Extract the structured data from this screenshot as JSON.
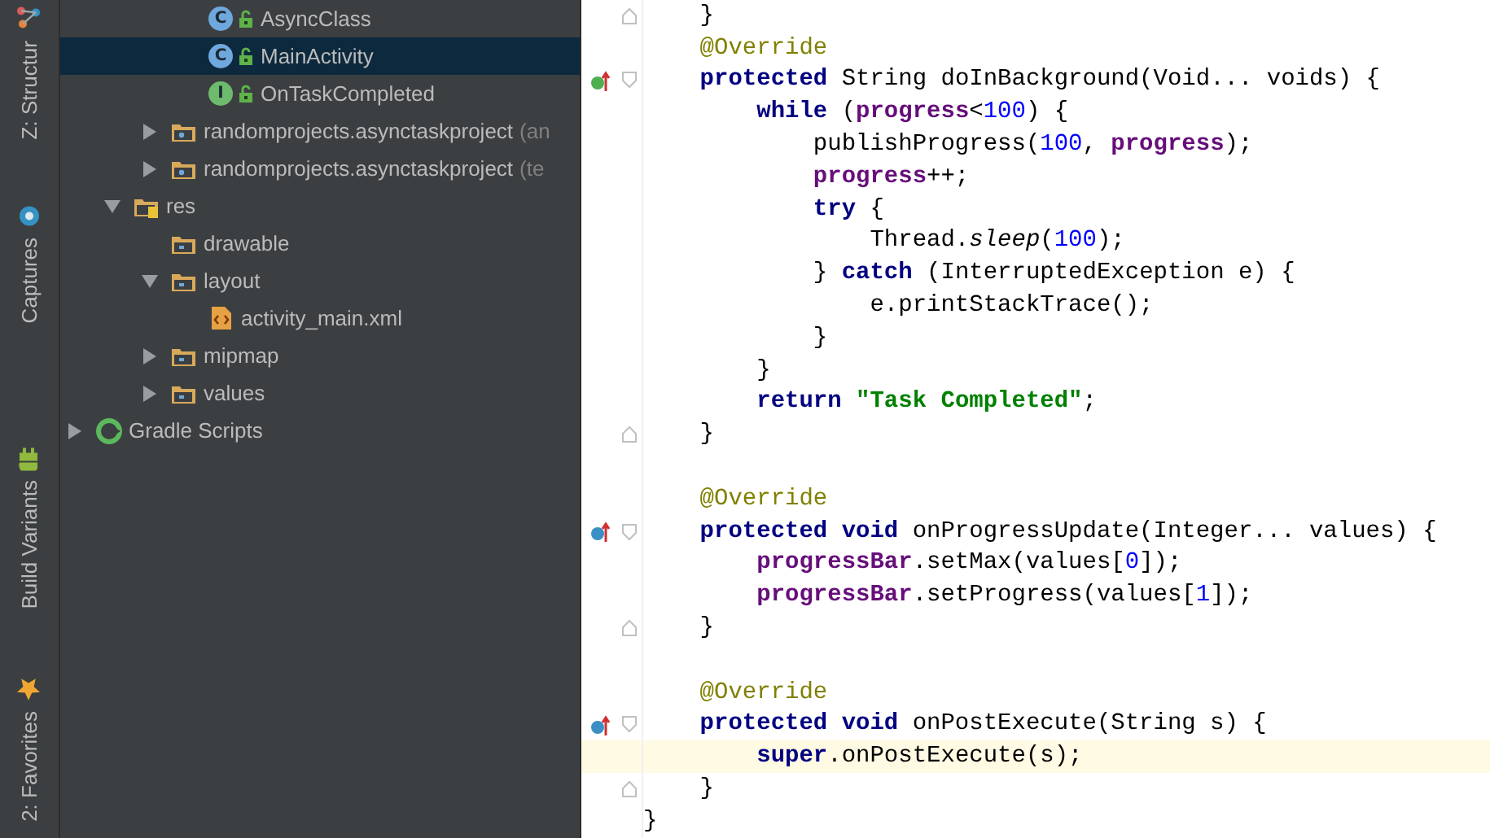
{
  "left_toolbar": {
    "top": [
      {
        "label": "Z: Structur",
        "kind": "structure"
      },
      {
        "label": "Captures",
        "kind": "captures"
      }
    ],
    "bottom": [
      {
        "label": "Build Variants",
        "kind": "android"
      },
      {
        "label": "2: Favorites",
        "kind": "star"
      }
    ]
  },
  "project_tree": [
    {
      "children": [
        {
          "children": [
            {
              "children": [
                {
                  "label": "AsyncClass",
                  "kind": "class",
                  "badge": "C",
                  "selected": false
                },
                {
                  "label": "MainActivity",
                  "kind": "class",
                  "badge": "C",
                  "selected": true
                },
                {
                  "label": "OnTaskCompleted",
                  "kind": "interface",
                  "badge": "I",
                  "selected": false
                }
              ]
            },
            {
              "label": "randomprojects.asynctaskproject",
              "suffix": "(an",
              "kind": "package",
              "expanded": false,
              "selected": false
            },
            {
              "label": "randomprojects.asynctaskproject",
              "suffix": "(te",
              "kind": "package",
              "expanded": false,
              "selected": false
            }
          ]
        },
        {
          "label": "res",
          "kind": "resfolder",
          "expanded": true,
          "selected": false,
          "children": [
            {
              "label": "drawable",
              "kind": "folder",
              "selected": false
            },
            {
              "label": "layout",
              "kind": "folder",
              "expanded": true,
              "selected": false,
              "children": [
                {
                  "label": "activity_main.xml",
                  "kind": "xml",
                  "selected": false
                }
              ]
            },
            {
              "label": "mipmap",
              "kind": "folder",
              "expanded": false,
              "selected": false
            },
            {
              "label": "values",
              "kind": "folder",
              "expanded": false,
              "selected": false
            }
          ]
        }
      ]
    },
    {
      "label": "Gradle Scripts",
      "kind": "gradle",
      "expanded": false,
      "selected": false
    }
  ],
  "editor": {
    "lines": [
      {
        "fold": {
          "kind": "end"
        },
        "current": false,
        "tokens": [
          {
            "kind": "plain",
            "text": "    }"
          }
        ]
      },
      {
        "current": false,
        "tokens": [
          {
            "kind": "annotation",
            "text": "    @Override"
          }
        ]
      },
      {
        "marker": {
          "kind": "implements"
        },
        "fold": {
          "kind": "start"
        },
        "current": false,
        "tokens": [
          {
            "kind": "keyword",
            "text": "    protected "
          },
          {
            "kind": "plain",
            "text": "String doInBackground(Void... voids) {"
          }
        ]
      },
      {
        "current": false,
        "tokens": [
          {
            "kind": "keyword",
            "text": "        while "
          },
          {
            "kind": "plain",
            "text": "("
          },
          {
            "kind": "field",
            "text": "progress"
          },
          {
            "kind": "plain",
            "text": "<"
          },
          {
            "kind": "number",
            "text": "100"
          },
          {
            "kind": "plain",
            "text": ") {"
          }
        ]
      },
      {
        "current": false,
        "tokens": [
          {
            "kind": "plain",
            "text": "            publishProgress("
          },
          {
            "kind": "number",
            "text": "100"
          },
          {
            "kind": "plain",
            "text": ", "
          },
          {
            "kind": "field",
            "text": "progress"
          },
          {
            "kind": "plain",
            "text": ");"
          }
        ]
      },
      {
        "current": false,
        "tokens": [
          {
            "kind": "field",
            "text": "            progress"
          },
          {
            "kind": "plain",
            "text": "++;"
          }
        ]
      },
      {
        "current": false,
        "tokens": [
          {
            "kind": "keyword",
            "text": "            try "
          },
          {
            "kind": "plain",
            "text": "{"
          }
        ]
      },
      {
        "current": false,
        "tokens": [
          {
            "kind": "plain",
            "text": "                Thread."
          },
          {
            "kind": "static_call",
            "text": "sleep"
          },
          {
            "kind": "plain",
            "text": "("
          },
          {
            "kind": "number",
            "text": "100"
          },
          {
            "kind": "plain",
            "text": ");"
          }
        ]
      },
      {
        "current": false,
        "tokens": [
          {
            "kind": "plain",
            "text": "            } "
          },
          {
            "kind": "keyword",
            "text": "catch "
          },
          {
            "kind": "plain",
            "text": "(InterruptedException e) {"
          }
        ]
      },
      {
        "current": false,
        "tokens": [
          {
            "kind": "plain",
            "text": "                e.printStackTrace();"
          }
        ]
      },
      {
        "current": false,
        "tokens": [
          {
            "kind": "plain",
            "text": "            }"
          }
        ]
      },
      {
        "current": false,
        "tokens": [
          {
            "kind": "plain",
            "text": "        }"
          }
        ]
      },
      {
        "current": false,
        "tokens": [
          {
            "kind": "keyword",
            "text": "        return "
          },
          {
            "kind": "string",
            "text": "\"Task Completed\""
          },
          {
            "kind": "plain",
            "text": ";"
          }
        ]
      },
      {
        "fold": {
          "kind": "end"
        },
        "current": false,
        "tokens": [
          {
            "kind": "plain",
            "text": "    }"
          }
        ]
      },
      {
        "current": false
      },
      {
        "current": false,
        "tokens": [
          {
            "kind": "annotation",
            "text": "    @Override"
          }
        ]
      },
      {
        "marker": {
          "kind": "overrides"
        },
        "fold": {
          "kind": "start"
        },
        "current": false,
        "tokens": [
          {
            "kind": "keyword",
            "text": "    protected void "
          },
          {
            "kind": "plain",
            "text": "onProgressUpdate(Integer... values) {"
          }
        ]
      },
      {
        "current": false,
        "tokens": [
          {
            "kind": "field",
            "text": "        progressBar"
          },
          {
            "kind": "plain",
            "text": ".setMax(values["
          },
          {
            "kind": "number",
            "text": "0"
          },
          {
            "kind": "plain",
            "text": "]);"
          }
        ]
      },
      {
        "current": false,
        "tokens": [
          {
            "kind": "field",
            "text": "        progressBar"
          },
          {
            "kind": "plain",
            "text": ".setProgress(values["
          },
          {
            "kind": "number",
            "text": "1"
          },
          {
            "kind": "plain",
            "text": "]);"
          }
        ]
      },
      {
        "fold": {
          "kind": "end"
        },
        "current": false,
        "tokens": [
          {
            "kind": "plain",
            "text": "    }"
          }
        ]
      },
      {
        "current": false
      },
      {
        "current": false,
        "tokens": [
          {
            "kind": "annotation",
            "text": "    @Override"
          }
        ]
      },
      {
        "marker": {
          "kind": "overrides"
        },
        "fold": {
          "kind": "start"
        },
        "current": false,
        "tokens": [
          {
            "kind": "keyword",
            "text": "    protected void "
          },
          {
            "kind": "plain",
            "text": "onPostExecute(String s) {"
          }
        ]
      },
      {
        "current": true,
        "tokens": [
          {
            "kind": "keyword",
            "text": "        super"
          },
          {
            "kind": "plain",
            "text": ".onPostExecute(s);"
          }
        ]
      },
      {
        "fold": {
          "kind": "end"
        },
        "current": false,
        "tokens": [
          {
            "kind": "plain",
            "text": "    }"
          }
        ]
      },
      {
        "current": false,
        "tokens": [
          {
            "kind": "plain",
            "text": "}"
          }
        ]
      }
    ]
  }
}
